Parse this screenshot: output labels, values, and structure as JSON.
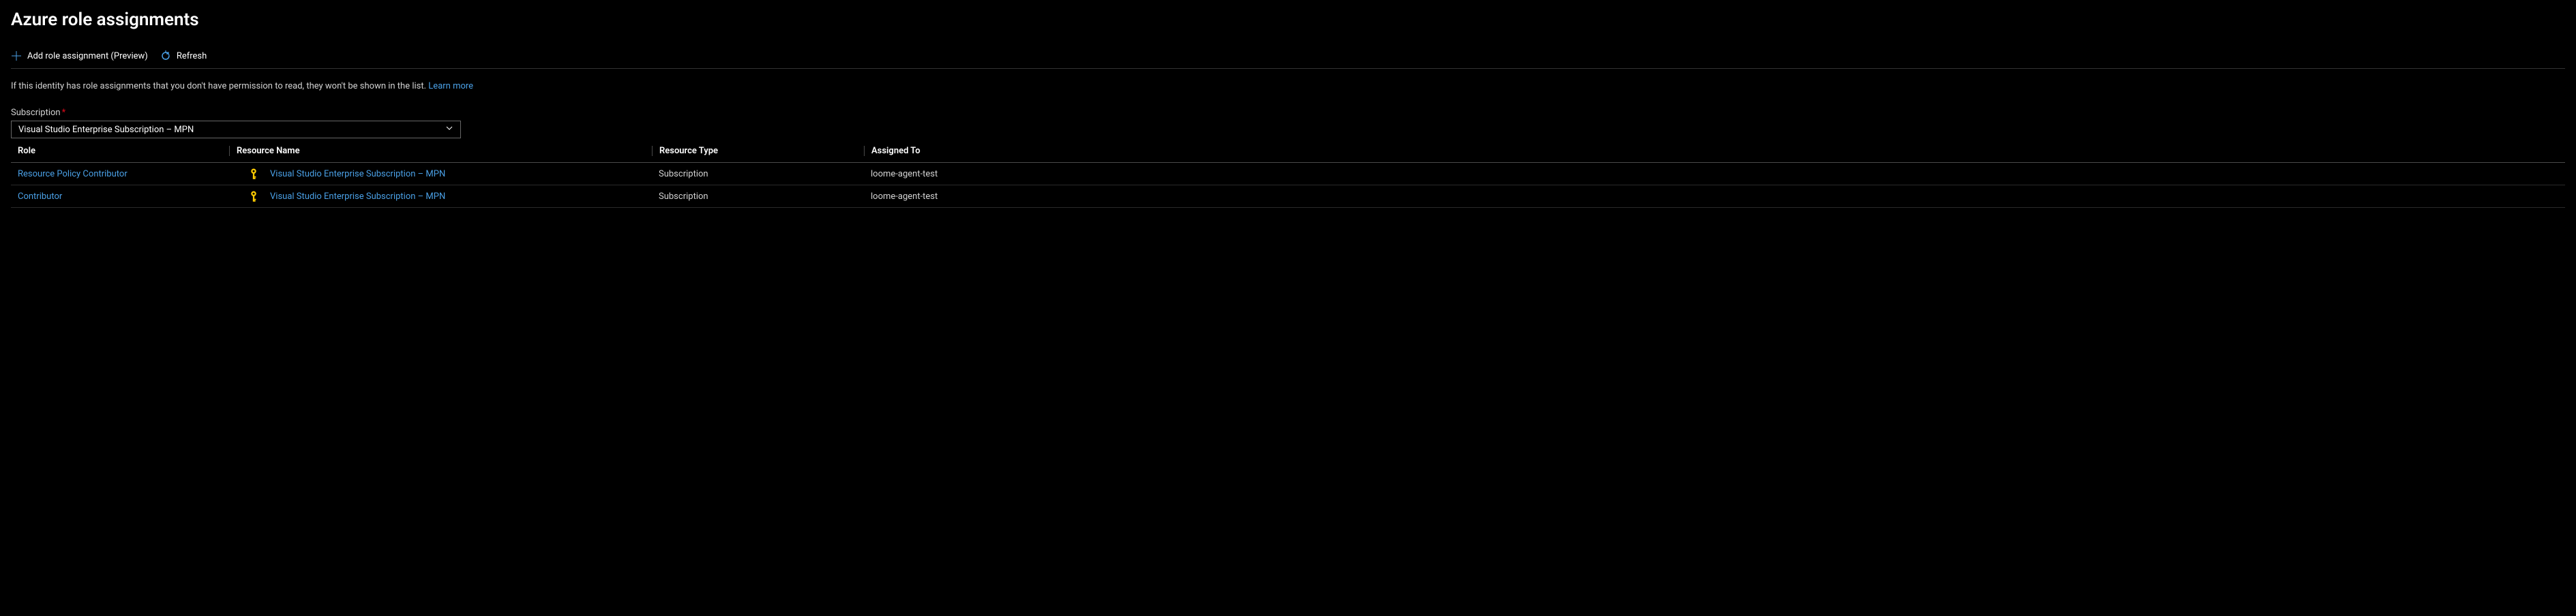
{
  "header": {
    "title": "Azure role assignments"
  },
  "toolbar": {
    "add_label": "Add role assignment (Preview)",
    "refresh_label": "Refresh"
  },
  "info": {
    "text": "If this identity has role assignments that you don't have permission to read, they won't be shown in the list.",
    "learn_more": "Learn more"
  },
  "subscription": {
    "label": "Subscription",
    "selected": "Visual Studio Enterprise Subscription – MPN"
  },
  "table": {
    "columns": {
      "role": "Role",
      "resource_name": "Resource Name",
      "resource_type": "Resource Type",
      "assigned_to": "Assigned To"
    },
    "rows": [
      {
        "role": "Resource Policy Contributor",
        "resource_name": "Visual Studio Enterprise Subscription – MPN",
        "resource_type": "Subscription",
        "assigned_to": "loome-agent-test"
      },
      {
        "role": "Contributor",
        "resource_name": "Visual Studio Enterprise Subscription – MPN",
        "resource_type": "Subscription",
        "assigned_to": "loome-agent-test"
      }
    ]
  }
}
